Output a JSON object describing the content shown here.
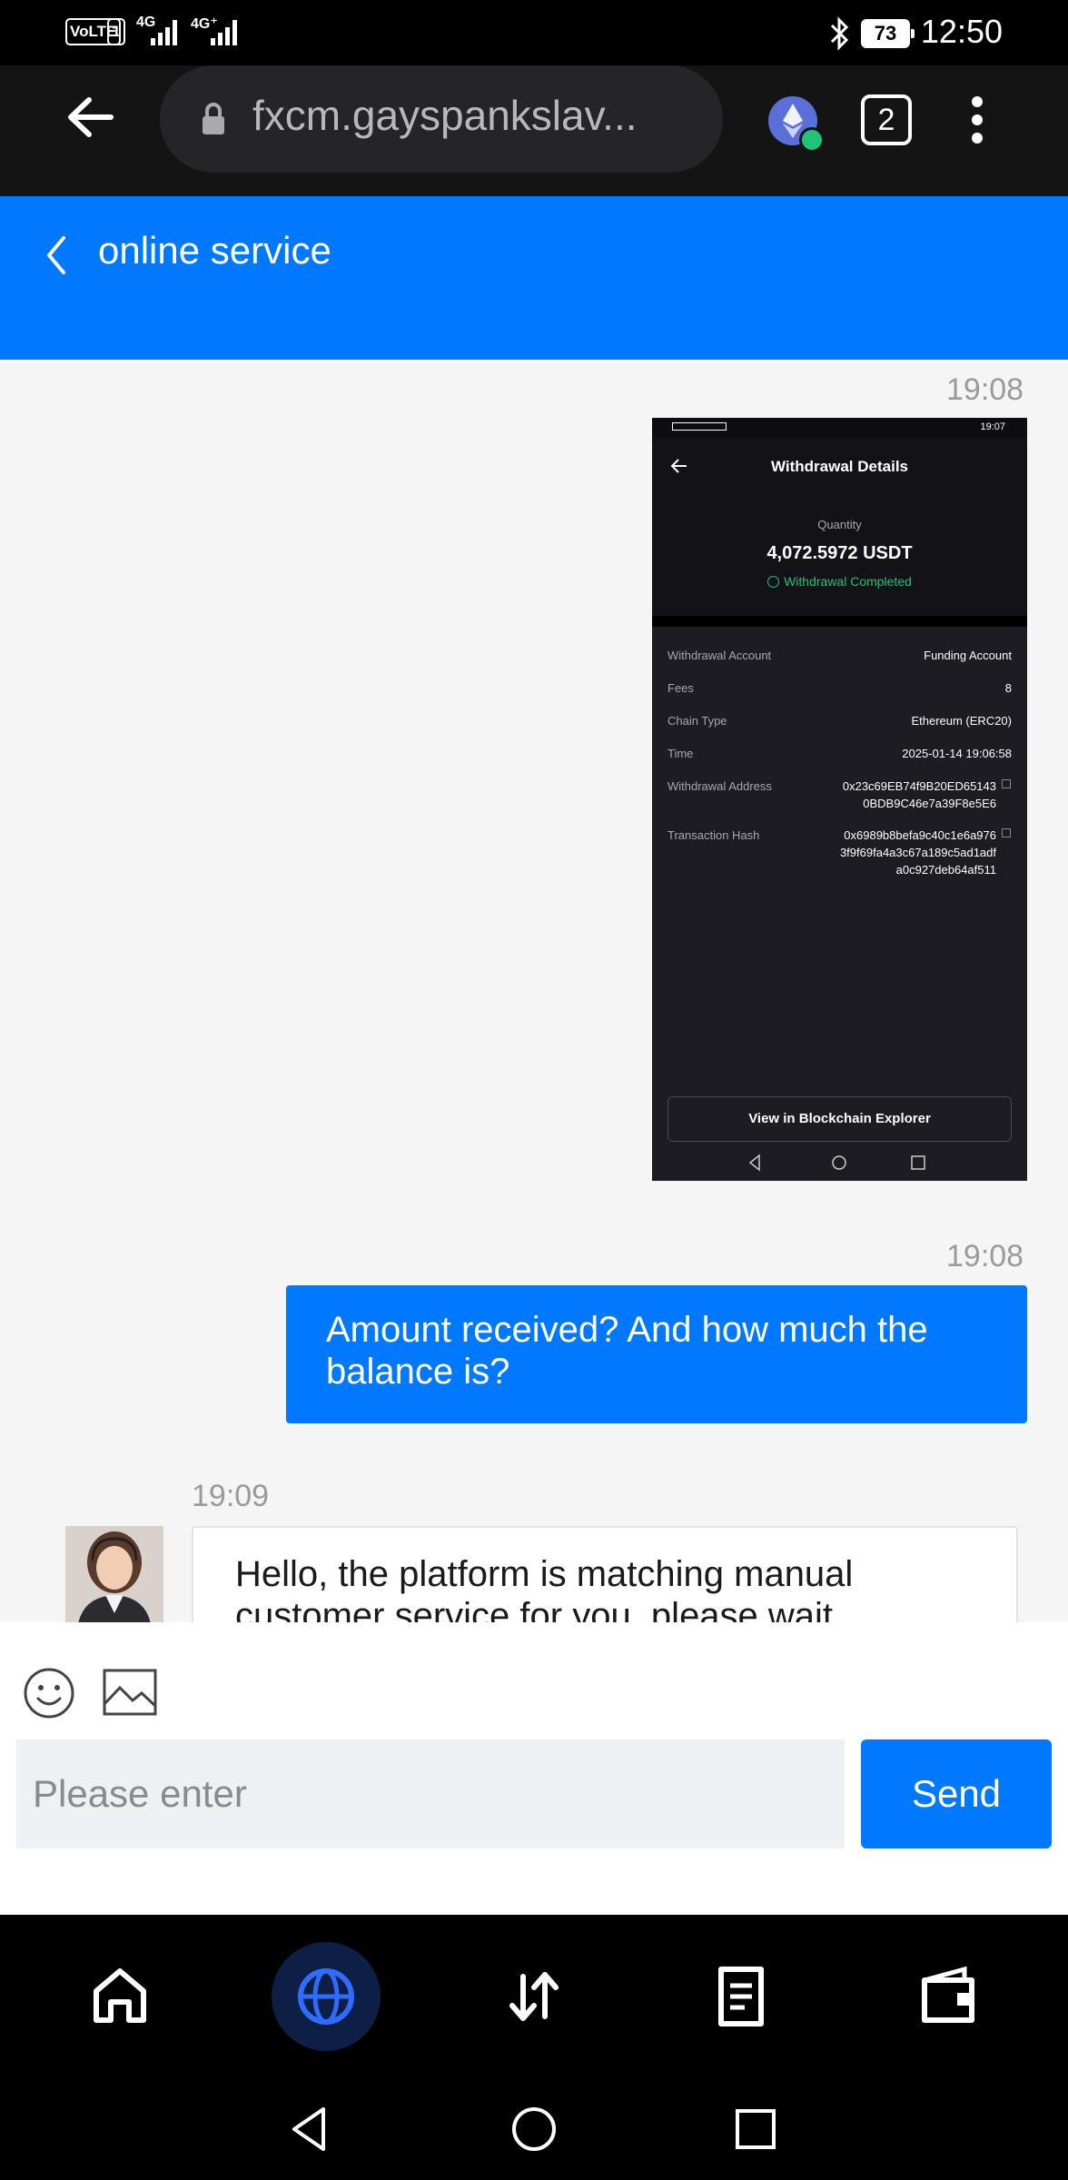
{
  "status_bar": {
    "volte": "VoLTE",
    "sim": "1",
    "net1": "4G",
    "net2": "4G⁺",
    "battery": "73",
    "time": "12:50"
  },
  "browser": {
    "url": "fxcm.gayspankslav...",
    "tab_count": "2",
    "icons": [
      "back-arrow-icon",
      "lock-icon",
      "ethereum-icon",
      "more-vertical-icon"
    ]
  },
  "header": {
    "title": "online service"
  },
  "chat": {
    "ts_image": "19:08",
    "ts_outgoing": "19:08",
    "ts_incoming": "19:09",
    "outgoing_text": "Amount received? And how much the balance is?",
    "incoming_text": "Hello, the platform is matching manual customer service for you, please wait"
  },
  "screenshot": {
    "status_time": "19:07",
    "title": "Withdrawal Details",
    "quantity_label": "Quantity",
    "quantity": "4,072.5972 USDT",
    "status": "Withdrawal Completed",
    "rows": [
      {
        "label": "Withdrawal Account",
        "value": "Funding Account"
      },
      {
        "label": "Fees",
        "value": "8"
      },
      {
        "label": "Chain Type",
        "value": "Ethereum (ERC20)"
      },
      {
        "label": "Time",
        "value": "2025-01-14 19:06:58"
      }
    ],
    "address_label": "Withdrawal Address",
    "address_1": "0x23c69EB74f9B20ED65143",
    "address_2": "0BDB9C46e7a39F8e5E6",
    "hash_label": "Transaction Hash",
    "hash_1": "0x6989b8befa9c40c1e6a976",
    "hash_2": "3f9f69fa4a3c67a189c5ad1adf",
    "hash_3": "a0c927deb64af511",
    "button": "View in Blockchain Explorer"
  },
  "input": {
    "placeholder": "Please enter",
    "send": "Send"
  },
  "nav": {
    "items": [
      "home-icon",
      "globe-icon",
      "transfer-icon",
      "orders-icon",
      "wallet-icon"
    ],
    "active": "globe-icon"
  },
  "colors": {
    "brand": "#0078ff",
    "success": "#21c27a"
  }
}
